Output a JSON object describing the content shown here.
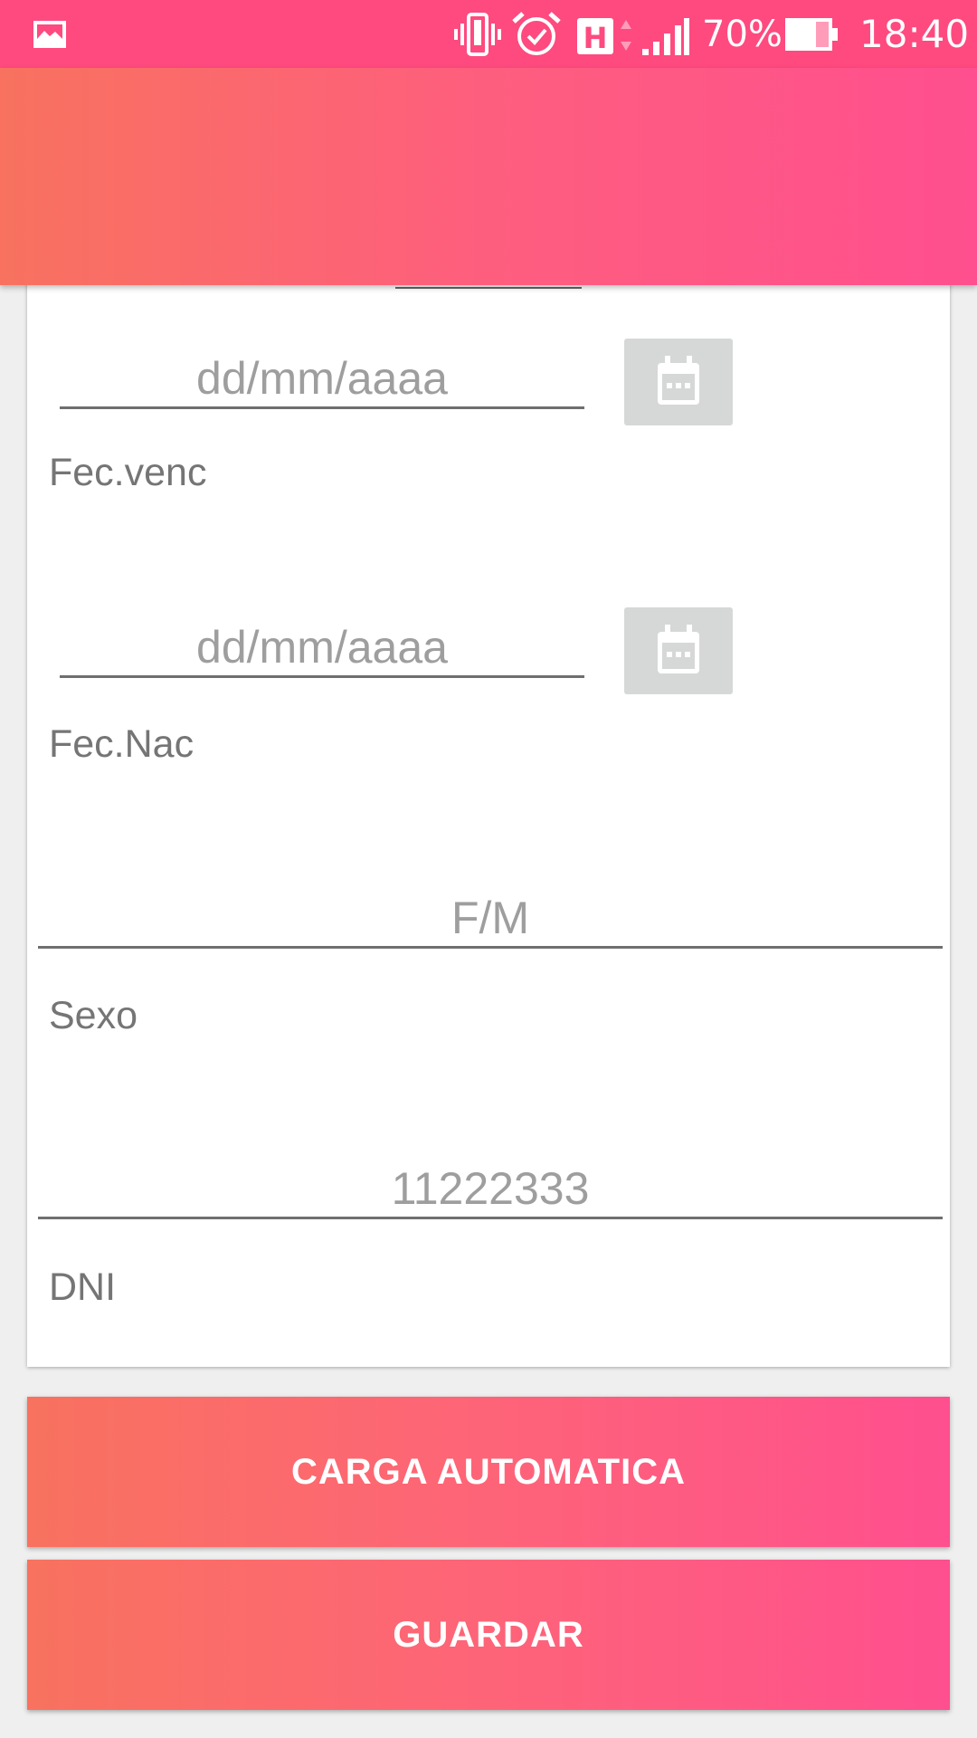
{
  "status_bar": {
    "battery_percent": "70%",
    "time": "18:40",
    "icons": [
      "gallery-icon",
      "vibrate-icon",
      "alarm-icon",
      "hspa-network-icon",
      "signal-icon",
      "battery-icon"
    ]
  },
  "form": {
    "fec_venc": {
      "placeholder": "dd/mm/aaaa",
      "label": "Fec.venc"
    },
    "fec_nac": {
      "placeholder": "dd/mm/aaaa",
      "label": "Fec.Nac"
    },
    "sexo": {
      "placeholder": "F/M",
      "label": "Sexo"
    },
    "dni": {
      "placeholder": "11222333",
      "label": "DNI"
    }
  },
  "buttons": {
    "auto_load": "CARGA AUTOMATICA",
    "save": "GUARDAR"
  },
  "colors": {
    "status_bar": "#fe4a7f",
    "gradient_start": "#f8725f",
    "gradient_end": "#ff4f8f",
    "calendar_button": "#d6d8d8"
  }
}
